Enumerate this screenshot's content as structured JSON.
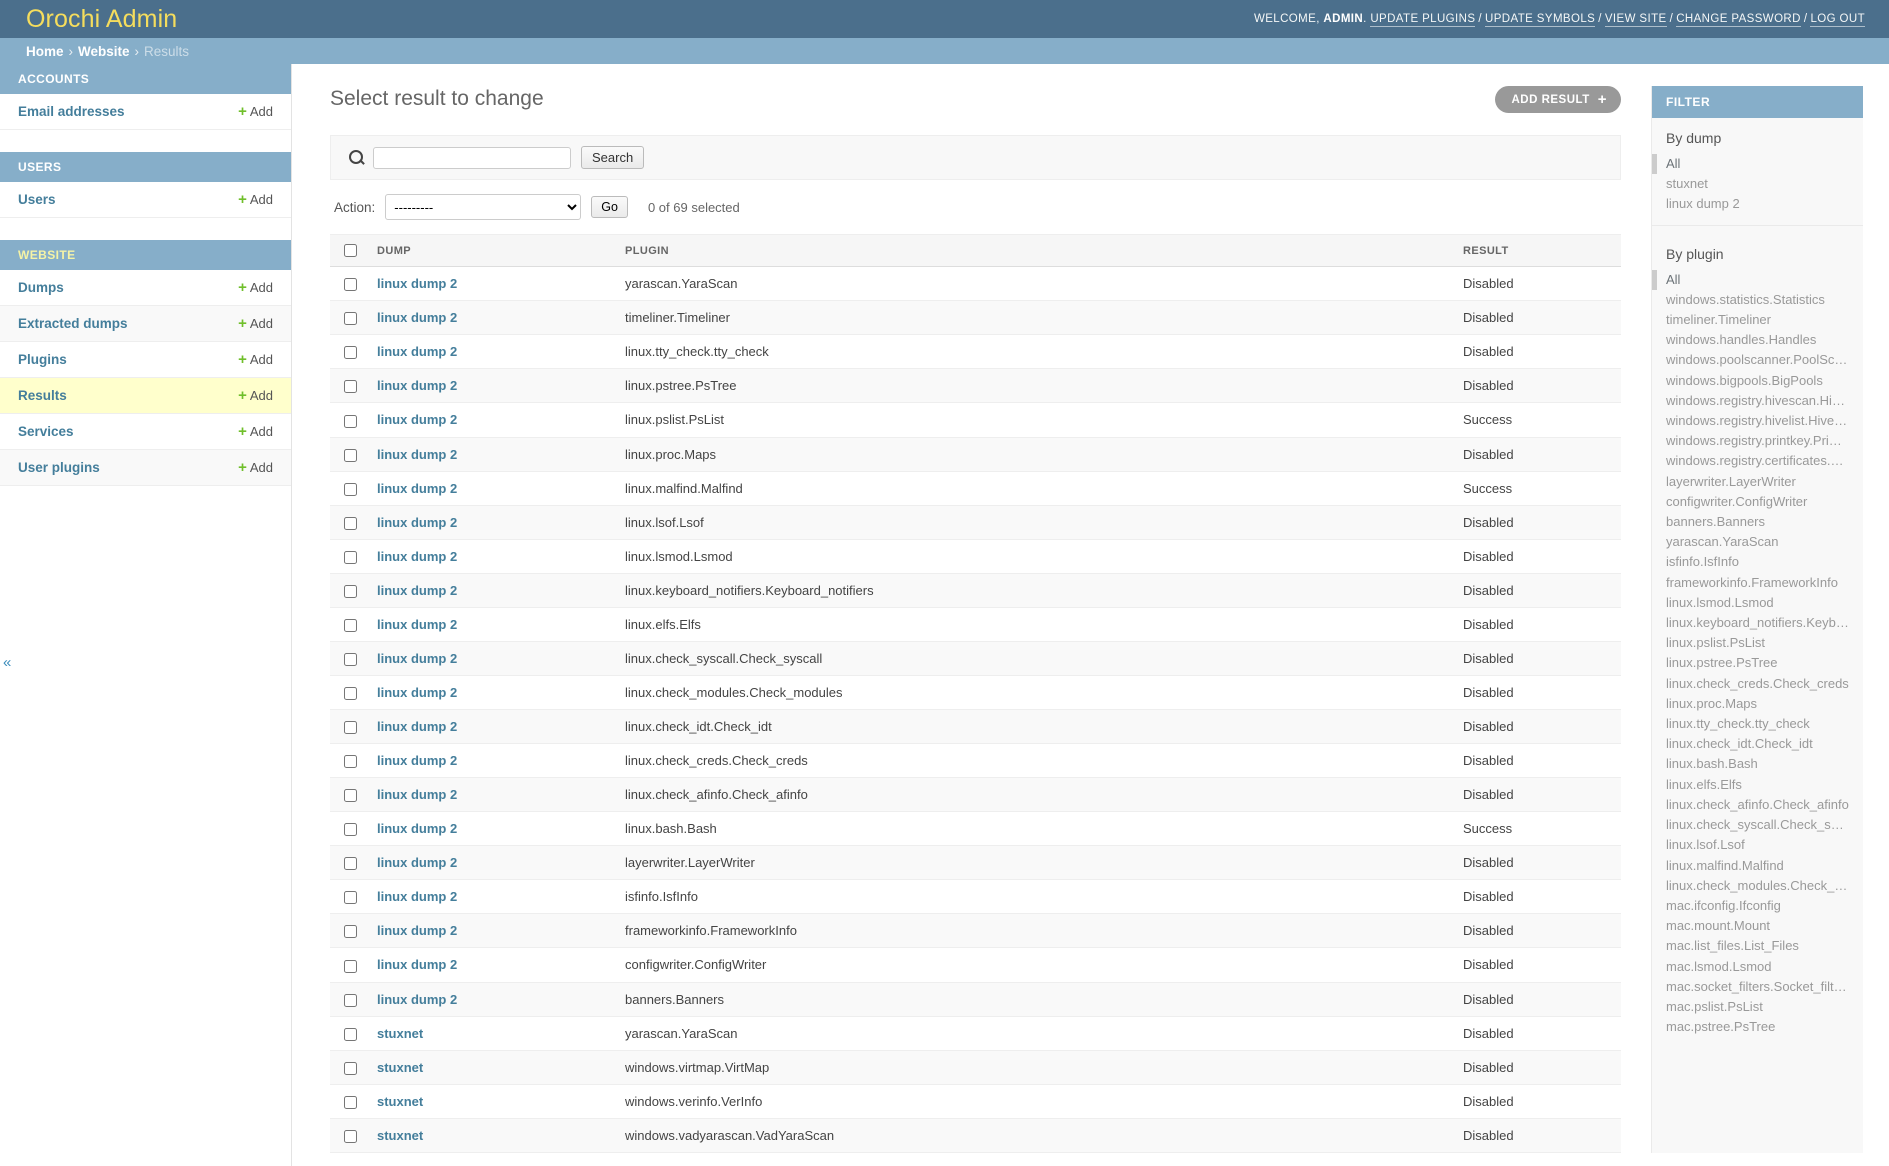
{
  "header": {
    "brand": "Orochi Admin",
    "welcome_prefix": "WELCOME,",
    "username": "ADMIN",
    "welcome_suffix": ".",
    "links": [
      {
        "label": "UPDATE PLUGINS"
      },
      {
        "label": "UPDATE SYMBOLS"
      },
      {
        "label": "VIEW SITE"
      },
      {
        "label": "CHANGE PASSWORD"
      },
      {
        "label": "LOG OUT"
      }
    ],
    "separator": "/"
  },
  "breadcrumbs": {
    "home": "Home",
    "section": "Website",
    "current": "Results",
    "separator": "›"
  },
  "sidebar": {
    "toggle_icon": "«",
    "add_label": "Add",
    "plus_icon": "+",
    "modules": [
      {
        "caption": "ACCOUNTS",
        "current": false,
        "items": [
          {
            "label": "Email addresses",
            "selected": false
          }
        ]
      },
      {
        "caption": "USERS",
        "current": false,
        "items": [
          {
            "label": "Users",
            "selected": false
          }
        ]
      },
      {
        "caption": "WEBSITE",
        "current": true,
        "items": [
          {
            "label": "Dumps",
            "selected": false
          },
          {
            "label": "Extracted dumps",
            "selected": false
          },
          {
            "label": "Plugins",
            "selected": false
          },
          {
            "label": "Results",
            "selected": true
          },
          {
            "label": "Services",
            "selected": false
          },
          {
            "label": "User plugins",
            "selected": false
          }
        ]
      }
    ]
  },
  "main": {
    "page_title": "Select result to change",
    "add_button_label": "ADD RESULT",
    "add_button_icon": "+",
    "search": {
      "value": "",
      "placeholder": "",
      "button_label": "Search",
      "icon": "search-icon"
    },
    "actions": {
      "label": "Action:",
      "selected_option": "---------",
      "options": [
        "---------"
      ],
      "go_label": "Go",
      "counter": "0 of 69 selected"
    },
    "table": {
      "columns": [
        "DUMP",
        "PLUGIN",
        "RESULT"
      ],
      "rows": [
        {
          "dump": "linux dump 2",
          "plugin": "yarascan.YaraScan",
          "result": "Disabled"
        },
        {
          "dump": "linux dump 2",
          "plugin": "timeliner.Timeliner",
          "result": "Disabled"
        },
        {
          "dump": "linux dump 2",
          "plugin": "linux.tty_check.tty_check",
          "result": "Disabled"
        },
        {
          "dump": "linux dump 2",
          "plugin": "linux.pstree.PsTree",
          "result": "Disabled"
        },
        {
          "dump": "linux dump 2",
          "plugin": "linux.pslist.PsList",
          "result": "Success"
        },
        {
          "dump": "linux dump 2",
          "plugin": "linux.proc.Maps",
          "result": "Disabled"
        },
        {
          "dump": "linux dump 2",
          "plugin": "linux.malfind.Malfind",
          "result": "Success"
        },
        {
          "dump": "linux dump 2",
          "plugin": "linux.lsof.Lsof",
          "result": "Disabled"
        },
        {
          "dump": "linux dump 2",
          "plugin": "linux.lsmod.Lsmod",
          "result": "Disabled"
        },
        {
          "dump": "linux dump 2",
          "plugin": "linux.keyboard_notifiers.Keyboard_notifiers",
          "result": "Disabled"
        },
        {
          "dump": "linux dump 2",
          "plugin": "linux.elfs.Elfs",
          "result": "Disabled"
        },
        {
          "dump": "linux dump 2",
          "plugin": "linux.check_syscall.Check_syscall",
          "result": "Disabled"
        },
        {
          "dump": "linux dump 2",
          "plugin": "linux.check_modules.Check_modules",
          "result": "Disabled"
        },
        {
          "dump": "linux dump 2",
          "plugin": "linux.check_idt.Check_idt",
          "result": "Disabled"
        },
        {
          "dump": "linux dump 2",
          "plugin": "linux.check_creds.Check_creds",
          "result": "Disabled"
        },
        {
          "dump": "linux dump 2",
          "plugin": "linux.check_afinfo.Check_afinfo",
          "result": "Disabled"
        },
        {
          "dump": "linux dump 2",
          "plugin": "linux.bash.Bash",
          "result": "Success"
        },
        {
          "dump": "linux dump 2",
          "plugin": "layerwriter.LayerWriter",
          "result": "Disabled"
        },
        {
          "dump": "linux dump 2",
          "plugin": "isfinfo.IsfInfo",
          "result": "Disabled"
        },
        {
          "dump": "linux dump 2",
          "plugin": "frameworkinfo.FrameworkInfo",
          "result": "Disabled"
        },
        {
          "dump": "linux dump 2",
          "plugin": "configwriter.ConfigWriter",
          "result": "Disabled"
        },
        {
          "dump": "linux dump 2",
          "plugin": "banners.Banners",
          "result": "Disabled"
        },
        {
          "dump": "stuxnet",
          "plugin": "yarascan.YaraScan",
          "result": "Disabled"
        },
        {
          "dump": "stuxnet",
          "plugin": "windows.virtmap.VirtMap",
          "result": "Disabled"
        },
        {
          "dump": "stuxnet",
          "plugin": "windows.verinfo.VerInfo",
          "result": "Disabled"
        },
        {
          "dump": "stuxnet",
          "plugin": "windows.vadyarascan.VadYaraScan",
          "result": "Disabled"
        }
      ]
    }
  },
  "filter": {
    "title": "FILTER",
    "groups": [
      {
        "heading": "By dump",
        "items": [
          {
            "label": "All",
            "selected": true
          },
          {
            "label": "stuxnet",
            "selected": false
          },
          {
            "label": "linux dump 2",
            "selected": false
          }
        ]
      },
      {
        "heading": "By plugin",
        "items": [
          {
            "label": "All",
            "selected": true
          },
          {
            "label": "windows.statistics.Statistics",
            "selected": false
          },
          {
            "label": "timeliner.Timeliner",
            "selected": false
          },
          {
            "label": "windows.handles.Handles",
            "selected": false
          },
          {
            "label": "windows.poolscanner.PoolScanner",
            "selected": false
          },
          {
            "label": "windows.bigpools.BigPools",
            "selected": false
          },
          {
            "label": "windows.registry.hivescan.HiveScan",
            "selected": false
          },
          {
            "label": "windows.registry.hivelist.HiveList",
            "selected": false
          },
          {
            "label": "windows.registry.printkey.PrintKey",
            "selected": false
          },
          {
            "label": "windows.registry.certificates.Certi…",
            "selected": false
          },
          {
            "label": "layerwriter.LayerWriter",
            "selected": false
          },
          {
            "label": "configwriter.ConfigWriter",
            "selected": false
          },
          {
            "label": "banners.Banners",
            "selected": false
          },
          {
            "label": "yarascan.YaraScan",
            "selected": false
          },
          {
            "label": "isfinfo.IsfInfo",
            "selected": false
          },
          {
            "label": "frameworkinfo.FrameworkInfo",
            "selected": false
          },
          {
            "label": "linux.lsmod.Lsmod",
            "selected": false
          },
          {
            "label": "linux.keyboard_notifiers.Keyboard_…",
            "selected": false
          },
          {
            "label": "linux.pslist.PsList",
            "selected": false
          },
          {
            "label": "linux.pstree.PsTree",
            "selected": false
          },
          {
            "label": "linux.check_creds.Check_creds",
            "selected": false
          },
          {
            "label": "linux.proc.Maps",
            "selected": false
          },
          {
            "label": "linux.tty_check.tty_check",
            "selected": false
          },
          {
            "label": "linux.check_idt.Check_idt",
            "selected": false
          },
          {
            "label": "linux.bash.Bash",
            "selected": false
          },
          {
            "label": "linux.elfs.Elfs",
            "selected": false
          },
          {
            "label": "linux.check_afinfo.Check_afinfo",
            "selected": false
          },
          {
            "label": "linux.check_syscall.Check_syscall",
            "selected": false
          },
          {
            "label": "linux.lsof.Lsof",
            "selected": false
          },
          {
            "label": "linux.malfind.Malfind",
            "selected": false
          },
          {
            "label": "linux.check_modules.Check_modu…",
            "selected": false
          },
          {
            "label": "mac.ifconfig.Ifconfig",
            "selected": false
          },
          {
            "label": "mac.mount.Mount",
            "selected": false
          },
          {
            "label": "mac.list_files.List_Files",
            "selected": false
          },
          {
            "label": "mac.lsmod.Lsmod",
            "selected": false
          },
          {
            "label": "mac.socket_filters.Socket_filters",
            "selected": false
          },
          {
            "label": "mac.pslist.PsList",
            "selected": false
          },
          {
            "label": "mac.pstree.PsTree",
            "selected": false
          }
        ]
      }
    ]
  },
  "colors": {
    "header_bg": "#4b6f8c",
    "breadcrumb_bg": "#86aec9",
    "brand_yellow": "#f5dd5d",
    "link_blue": "#447e9b",
    "add_green": "#70bf2b",
    "selected_row": "#ffffcc"
  }
}
